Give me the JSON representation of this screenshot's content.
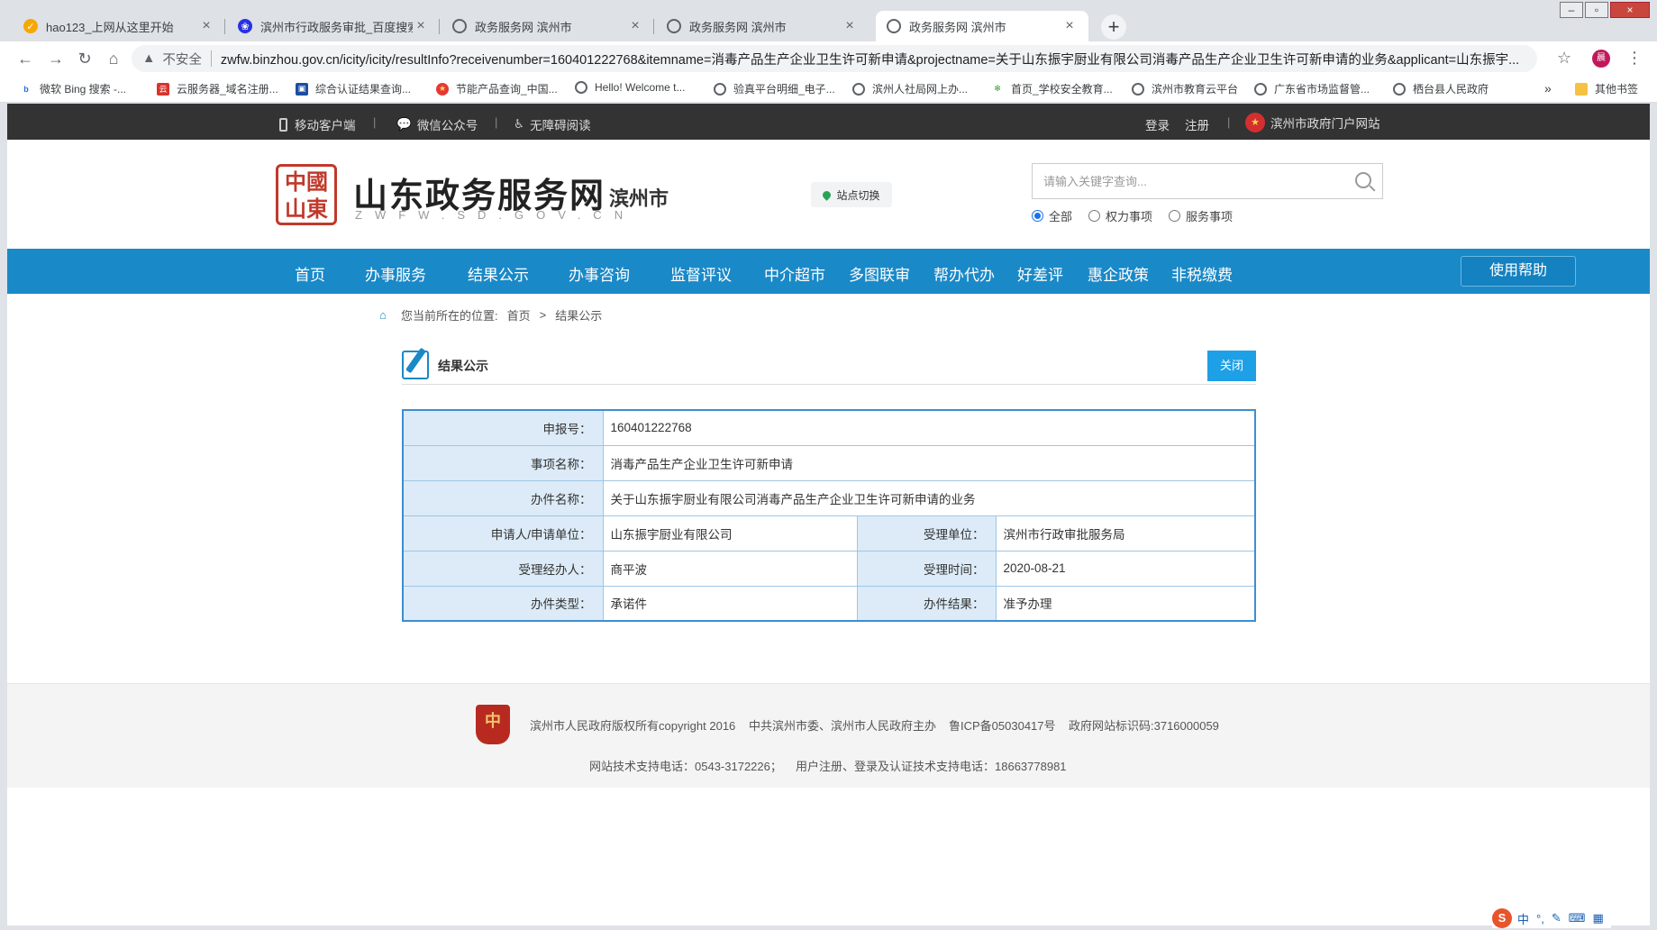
{
  "browser": {
    "tabs": [
      {
        "title": "hao123_上网从这里开始",
        "icon": "hao123-icon",
        "active": false
      },
      {
        "title": "滨州市行政服务审批_百度搜索",
        "icon": "baidu-icon",
        "active": false
      },
      {
        "title": "政务服务网 滨州市",
        "icon": "globe-icon",
        "active": false
      },
      {
        "title": "政务服务网 滨州市",
        "icon": "globe-icon",
        "active": false
      },
      {
        "title": "政务服务网 滨州市",
        "icon": "globe-icon",
        "active": true
      }
    ],
    "new_tab": "+",
    "security_label": "不安全",
    "url": "zwfw.binzhou.gov.cn/icity/icity/resultInfo?receivenumber=160401222768&itemname=消毒产品生产企业卫生许可新申请&projectname=关于山东振宇厨业有限公司消毒产品生产企业卫生许可新申请的业务&applicant=山东振宇...",
    "profile_initial": "晨",
    "bookmarks": [
      "微软 Bing 搜索 -...",
      "云服务器_域名注册...",
      "综合认证结果查询...",
      "节能产品查询_中国...",
      "Hello! Welcome t...",
      "验真平台明细_电子...",
      "滨州人社局网上办...",
      "首页_学校安全教育...",
      "滨州市教育云平台",
      "广东省市场监督管...",
      "栖台县人民政府"
    ],
    "bookmarks_more": "»",
    "other_bookmarks": "其他书签"
  },
  "topbar": {
    "mobile": "移动客户端",
    "wechat": "微信公众号",
    "accessible": "无障碍阅读",
    "login": "登录",
    "register": "注册",
    "portal": "滨州市政府门户网站"
  },
  "header": {
    "seal_text": "中國山東",
    "brand": "山东政务服务网",
    "brand_sub": "ZWFW.SD.GOV.CN",
    "city": "滨州市",
    "site_switch": "站点切换",
    "search_placeholder": "请输入关键字查询...",
    "radios": [
      {
        "label": "全部",
        "checked": true
      },
      {
        "label": "权力事项",
        "checked": false
      },
      {
        "label": "服务事项",
        "checked": false
      }
    ]
  },
  "nav": {
    "items": [
      "首页",
      "办事服务",
      "结果公示",
      "办事咨询",
      "监督评议",
      "中介超市",
      "多图联审",
      "帮办代办",
      "好差评",
      "惠企政策",
      "非税缴费"
    ],
    "help": "使用帮助"
  },
  "breadcrumb": {
    "prefix": "您当前所在的位置:",
    "home": "首页",
    "sep": ">",
    "current": "结果公示"
  },
  "section": {
    "title": "结果公示",
    "close": "关闭"
  },
  "record": {
    "receive_no_label": "申报号：",
    "receive_no": "160401222768",
    "item_label": "事项名称：",
    "item": "消毒产品生产企业卫生许可新申请",
    "project_label": "办件名称：",
    "project": "关于山东振宇厨业有限公司消毒产品生产企业卫生许可新申请的业务",
    "applicant_label": "申请人/申请单位：",
    "applicant": "山东振宇厨业有限公司",
    "dept_label": "受理单位：",
    "dept": "滨州市行政审批服务局",
    "handler_label": "受理经办人：",
    "handler": "商平波",
    "time_label": "受理时间：",
    "time": "2020-08-21",
    "type_label": "办件类型：",
    "type": "承诺件",
    "result_label": "办件结果：",
    "result": "准予办理"
  },
  "footer": {
    "badge": "中",
    "copyright": "滨州市人民政府版权所有copyright 2016",
    "sponsor": "中共滨州市委、滨州市人民政府主办",
    "icp": "鲁ICP备05030417号",
    "site_id": "政府网站标识码:3716000059",
    "tech_phone": "网站技术支持电话：0543-3172226；",
    "user_phone": "用户注册、登录及认证技术支持电话：18663778981"
  },
  "ime": {
    "logo": "S",
    "mode": "中",
    "punct": "°,",
    "pen": "✎",
    "keyboard": "⌨",
    "grid": "▦"
  }
}
